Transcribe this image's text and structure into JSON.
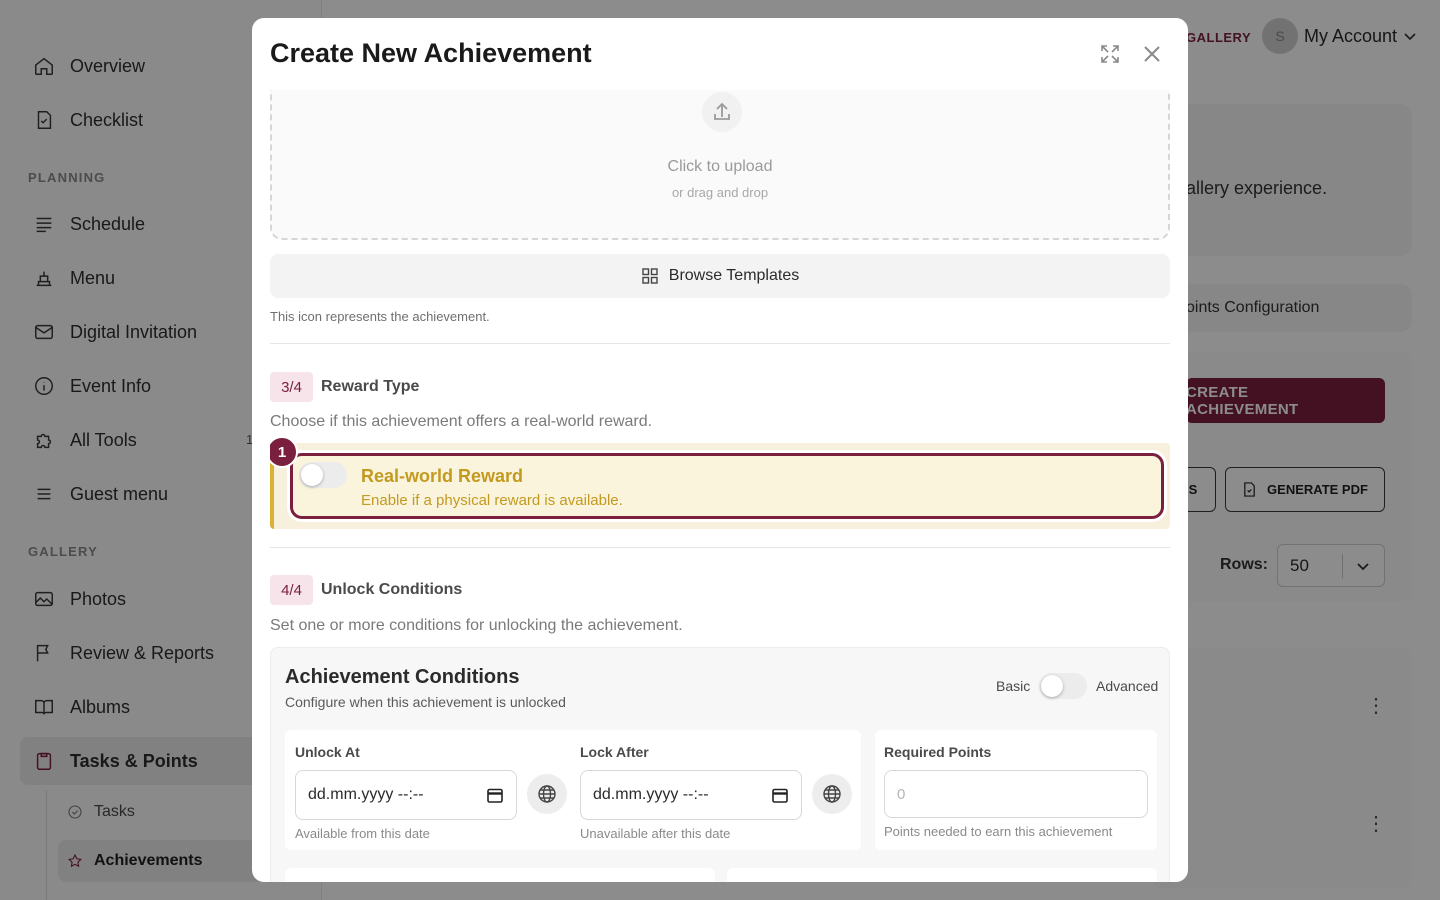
{
  "sidebar": {
    "top_items": [
      {
        "label": "Overview",
        "icon": "home-icon"
      },
      {
        "label": "Checklist",
        "icon": "checklist-icon"
      }
    ],
    "sections": [
      {
        "title": "PLANNING",
        "items": [
          {
            "label": "Schedule",
            "icon": "schedule-icon"
          },
          {
            "label": "Menu",
            "icon": "menu-food-icon"
          },
          {
            "label": "Digital Invitation",
            "icon": "mail-icon"
          },
          {
            "label": "Event Info",
            "icon": "info-icon"
          },
          {
            "label": "All Tools",
            "icon": "puzzle-icon",
            "badge": "1"
          },
          {
            "label": "Guest menu",
            "icon": "list-icon"
          }
        ]
      },
      {
        "title": "GALLERY",
        "items": [
          {
            "label": "Photos",
            "icon": "photo-icon"
          },
          {
            "label": "Review & Reports",
            "icon": "flag-icon"
          },
          {
            "label": "Albums",
            "icon": "book-icon"
          },
          {
            "label": "Tasks & Points",
            "icon": "clipboard-icon",
            "active": true
          }
        ]
      }
    ],
    "sub_items": [
      {
        "label": "Tasks",
        "icon": "check-circle-icon"
      },
      {
        "label": "Achievements",
        "icon": "star-icon",
        "active": true
      }
    ]
  },
  "header": {
    "gallery_link": "GALLERY",
    "account_initial": "S",
    "account_label": "My Account"
  },
  "background": {
    "intro_text": "allery experience.",
    "points_tab": "oints Configuration",
    "create_button": "CREATE ACHIEVEMENT",
    "partial_button": "S",
    "pdf_button": "GENERATE PDF",
    "rows_label": "Rows:",
    "rows_value": "50"
  },
  "modal": {
    "title": "Create New Achievement",
    "upload": {
      "title": "Click to upload",
      "subtitle": "or drag and drop"
    },
    "browse_templates": "Browse Templates",
    "icon_hint": "This icon represents the achievement.",
    "step3": {
      "badge": "3/4",
      "title": "Reward Type",
      "description": "Choose if this achievement offers a real-world reward.",
      "toggle_title": "Real-world Reward",
      "toggle_subtitle": "Enable if a physical reward is available.",
      "toggle_on": false
    },
    "tour_step": "1",
    "step4": {
      "badge": "4/4",
      "title": "Unlock Conditions",
      "description": "Set one or more conditions for unlocking the achievement."
    },
    "conditions": {
      "title": "Achievement Conditions",
      "subtitle": "Configure when this achievement is unlocked",
      "mode_basic": "Basic",
      "mode_advanced": "Advanced",
      "unlock_at": {
        "label": "Unlock At",
        "value": "dd.mm.yyyy --:--",
        "help": "Available from this date"
      },
      "lock_after": {
        "label": "Lock After",
        "value": "dd.mm.yyyy --:--",
        "help": "Unavailable after this date"
      },
      "required_points": {
        "label": "Required Points",
        "placeholder": "0",
        "help": "Points needed to earn this achievement"
      }
    }
  },
  "colors": {
    "brand": "#7a1f3d",
    "reward_accent": "#c29a20",
    "reward_bg": "#f7f0dc"
  }
}
